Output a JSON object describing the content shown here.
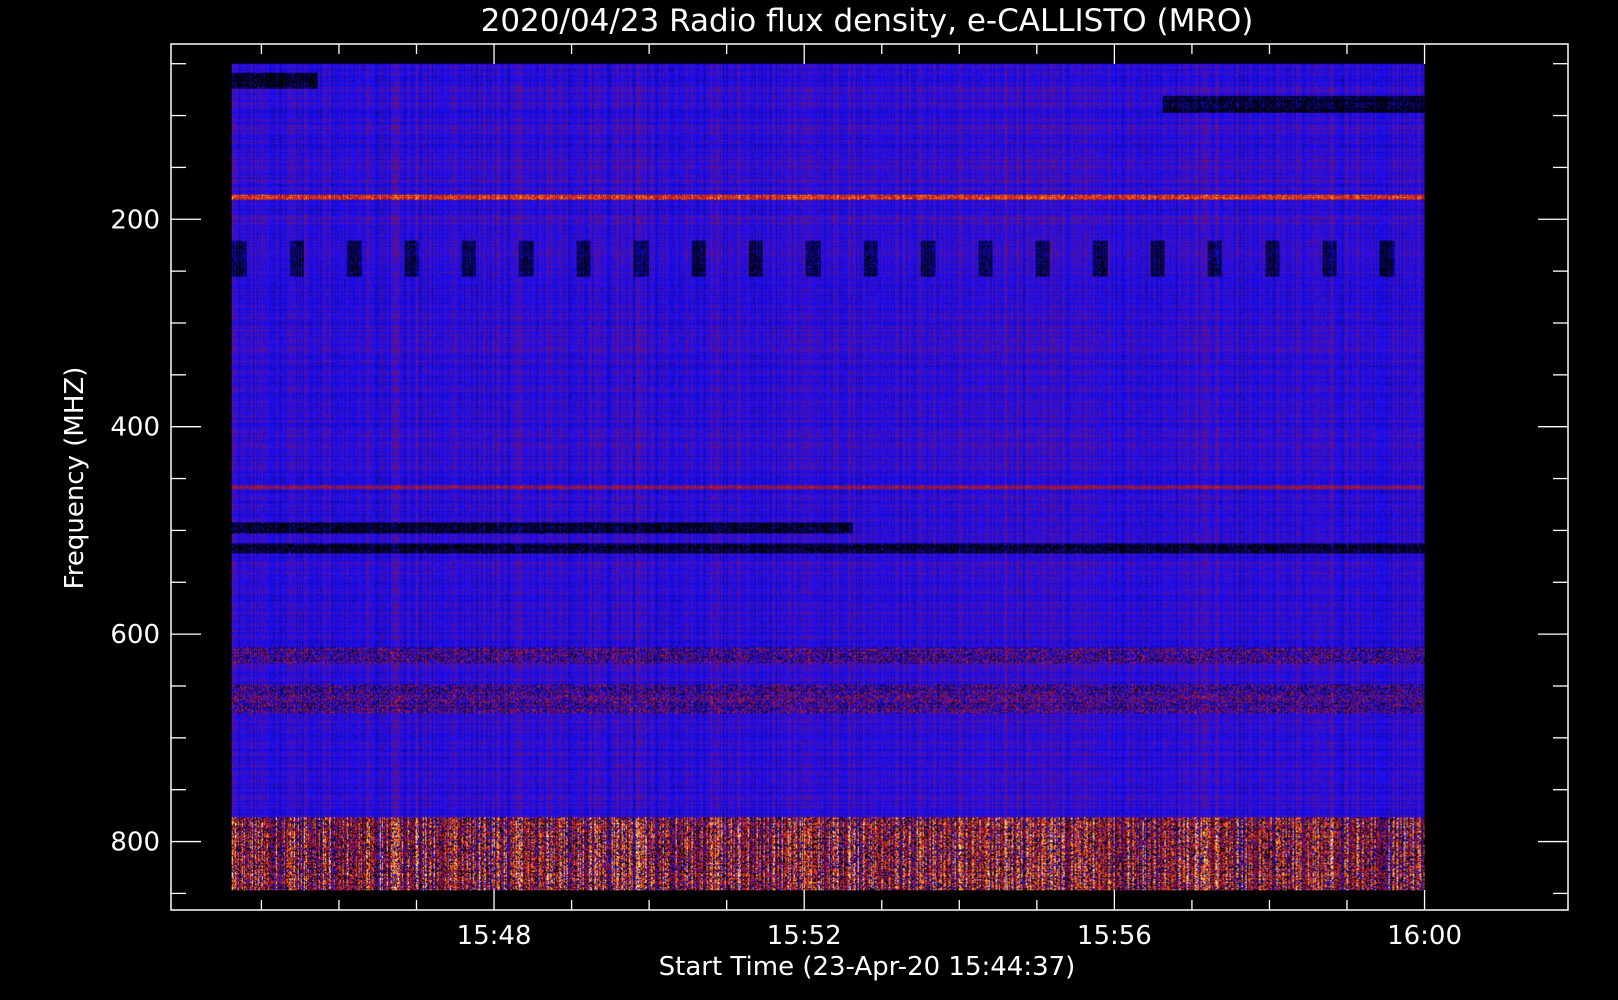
{
  "chart_data": {
    "type": "heatmap",
    "title": "2020/04/23  Radio flux density, e-CALLISTO (MRO)",
    "xlabel": "Start Time (23-Apr-20 15:44:37)",
    "ylabel": "Frequency (MHZ)",
    "x_tick_labels": [
      "15:48",
      "15:52",
      "15:56",
      "16:00"
    ],
    "x_tick_values_min": [
      3.383,
      7.383,
      11.383,
      15.383
    ],
    "x_range_min": [
      -0.783,
      17.233
    ],
    "x_data_range_min": [
      0,
      15.383
    ],
    "y_tick_labels": [
      "200",
      "400",
      "600",
      "800"
    ],
    "y_tick_values": [
      200,
      400,
      600,
      800
    ],
    "y_range": [
      31,
      866
    ],
    "y_data_range": [
      50,
      847
    ],
    "y_inverted": true,
    "colors": {
      "background": "#000000",
      "axes": "#ffffff",
      "low": "#000000",
      "base": "#1a0dff",
      "mid": "#8a1540",
      "high": "#d01515",
      "peak": "#ff9a00",
      "max": "#ffffff"
    },
    "features": [
      {
        "kind": "persistent_line",
        "freq_mhz": 178,
        "level": "high"
      },
      {
        "kind": "persistent_line",
        "freq_mhz": 458,
        "level": "mid"
      },
      {
        "kind": "dark_band",
        "freq_range_mhz": [
          492,
          502
        ],
        "t_range_min": [
          0,
          8
        ]
      },
      {
        "kind": "dark_band",
        "freq_range_mhz": [
          512,
          522
        ],
        "t_range_min": [
          0,
          15.383
        ]
      },
      {
        "kind": "noisy_band",
        "freq_range_mhz": [
          612,
          628
        ],
        "t_range_min": [
          0,
          15.383
        ]
      },
      {
        "kind": "noisy_band",
        "freq_range_mhz": [
          648,
          676
        ],
        "t_range_min": [
          0,
          15.383
        ]
      },
      {
        "kind": "strong_band",
        "freq_range_mhz": [
          776,
          847
        ],
        "t_range_min": [
          0,
          15.383
        ]
      },
      {
        "kind": "dark_band",
        "freq_range_mhz": [
          80,
          97
        ],
        "t_range_min": [
          12.0,
          15.383
        ]
      },
      {
        "kind": "dark_band",
        "freq_range_mhz": [
          58,
          74
        ],
        "t_range_min": [
          0,
          1.1
        ]
      },
      {
        "kind": "periodic_dark_columns",
        "freq_range_mhz": [
          220,
          255
        ],
        "period_min": 0.74
      }
    ]
  }
}
